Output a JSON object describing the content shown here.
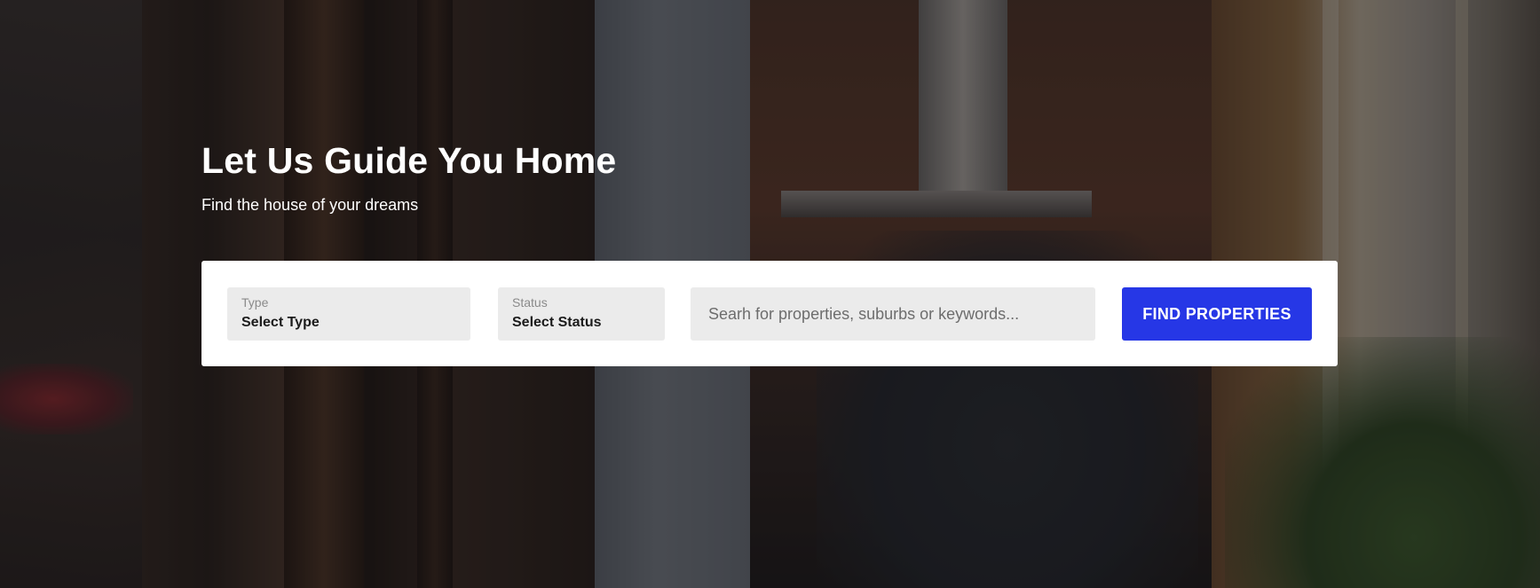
{
  "hero": {
    "title": "Let Us Guide You Home",
    "subtitle": "Find the house of your dreams"
  },
  "search_form": {
    "type_select": {
      "label": "Type",
      "value": "Select Type"
    },
    "status_select": {
      "label": "Status",
      "value": "Select Status"
    },
    "keyword_input": {
      "placeholder": "Searh for properties, suburbs or keywords...",
      "value": ""
    },
    "submit_label": "FIND PROPERTIES"
  },
  "colors": {
    "accent": "#2637e6",
    "field_background": "#ebebeb",
    "panel_background": "#ffffff",
    "hero_text": "#ffffff"
  }
}
